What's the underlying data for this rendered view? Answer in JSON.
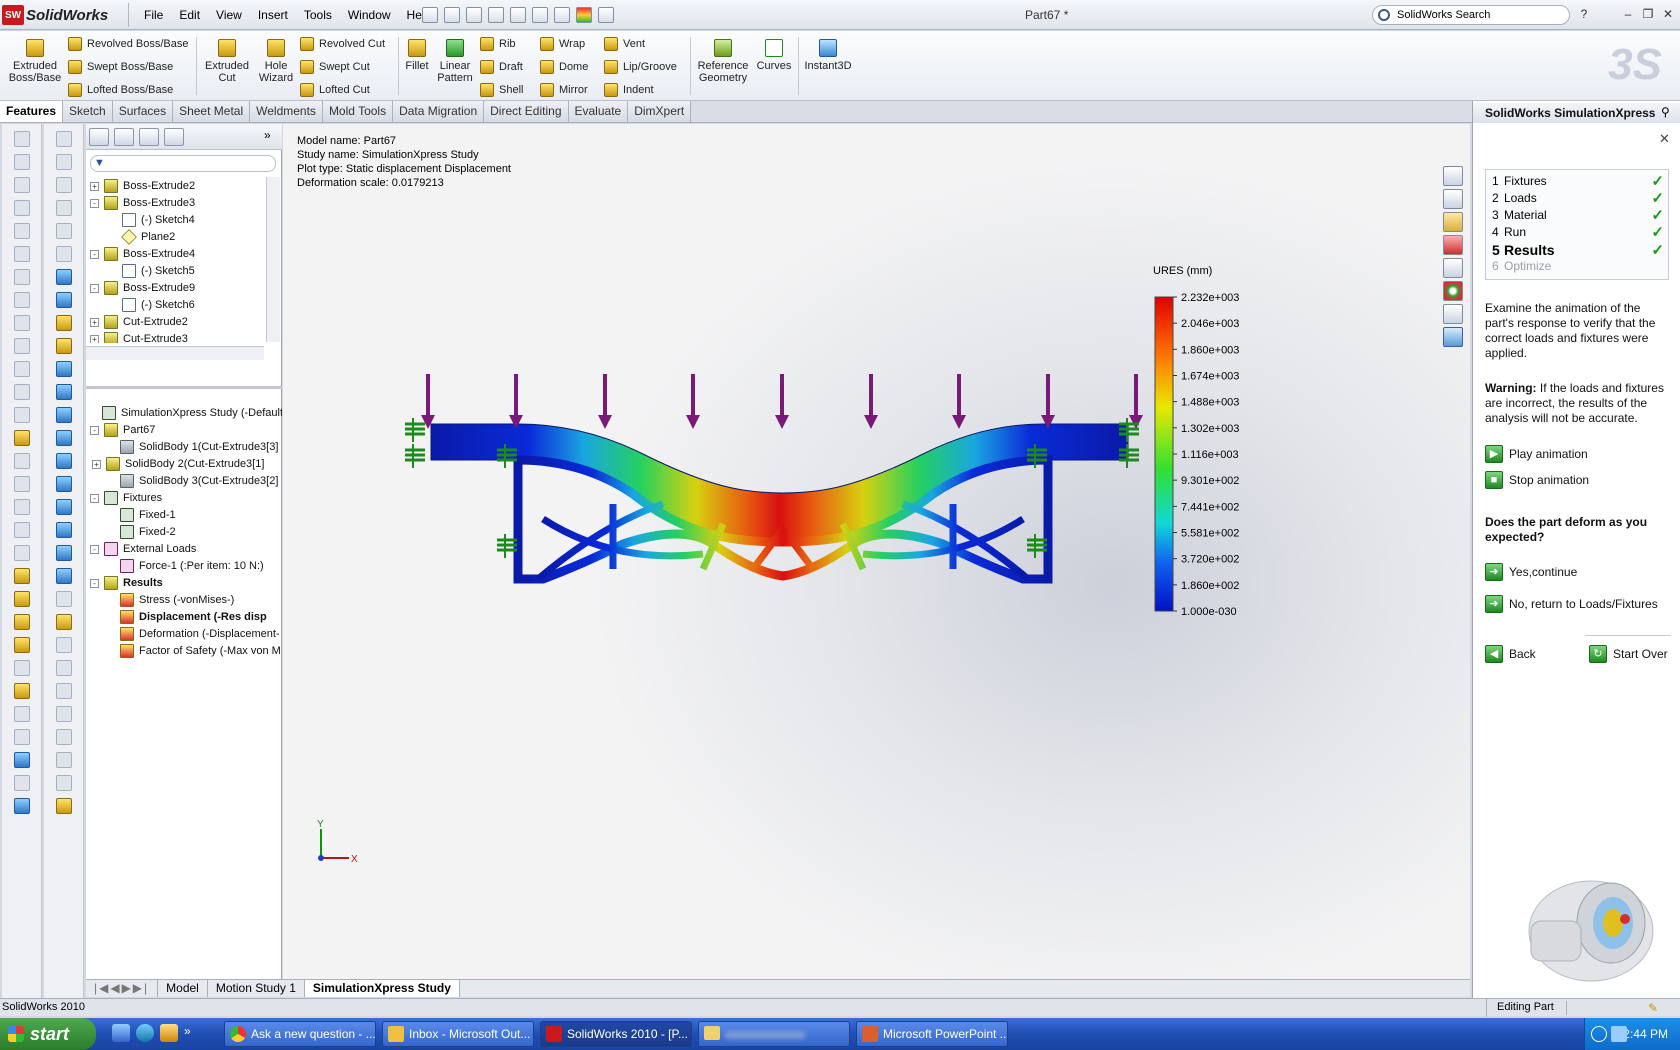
{
  "app": {
    "name": "SolidWorks",
    "logo": "SW",
    "doc_title": "Part67 *"
  },
  "menu": [
    "File",
    "Edit",
    "View",
    "Insert",
    "Tools",
    "Window",
    "Help"
  ],
  "search": {
    "placeholder": "SolidWorks Search"
  },
  "commands": {
    "extruded_boss": "Extruded Boss/Base",
    "revolved_boss": "Revolved Boss/Base",
    "swept_boss": "Swept Boss/Base",
    "lofted_boss": "Lofted Boss/Base",
    "extruded_cut": "Extruded Cut",
    "hole_wizard": "Hole Wizard",
    "revolved_cut": "Revolved Cut",
    "swept_cut": "Swept Cut",
    "lofted_cut": "Lofted Cut",
    "fillet": "Fillet",
    "linear_pattern": "Linear Pattern",
    "rib": "Rib",
    "draft": "Draft",
    "shell": "Shell",
    "wrap": "Wrap",
    "dome": "Dome",
    "mirror": "Mirror",
    "vent": "Vent",
    "lip_groove": "Lip/Groove",
    "indent": "Indent",
    "reference_geometry": "Reference Geometry",
    "curves": "Curves",
    "instant3d": "Instant3D"
  },
  "tabs": [
    "Features",
    "Sketch",
    "Surfaces",
    "Sheet Metal",
    "Weldments",
    "Mold Tools",
    "Data Migration",
    "Direct Editing",
    "Evaluate",
    "DimXpert"
  ],
  "feature_tree": [
    {
      "label": "Boss-Extrude2",
      "expand": "+",
      "icon": "feature"
    },
    {
      "label": "Boss-Extrude3",
      "expand": "-",
      "icon": "feature"
    },
    {
      "label": "(-) Sketch4",
      "expand": "",
      "icon": "sketch"
    },
    {
      "label": "Plane2",
      "expand": "",
      "icon": "plane"
    },
    {
      "label": "Boss-Extrude4",
      "expand": "-",
      "icon": "feature"
    },
    {
      "label": "(-) Sketch5",
      "expand": "",
      "icon": "sketch"
    },
    {
      "label": "Boss-Extrude9",
      "expand": "-",
      "icon": "feature"
    },
    {
      "label": "(-) Sketch6",
      "expand": "",
      "icon": "sketch"
    },
    {
      "label": "Cut-Extrude2",
      "expand": "+",
      "icon": "feature"
    },
    {
      "label": "Cut-Extrude3",
      "expand": "+",
      "icon": "feature"
    }
  ],
  "sim_tree": [
    {
      "label": "SimulationXpress Study (-Default-)",
      "expand": "",
      "icon": "study",
      "bold": false
    },
    {
      "label": "Part67",
      "expand": "-",
      "icon": "feature",
      "bold": false
    },
    {
      "label": "SolidBody 1(Cut-Extrude3[3]",
      "expand": "",
      "icon": "body",
      "bold": false
    },
    {
      "label": "SolidBody 2(Cut-Extrude3[1]",
      "expand": "+",
      "icon": "feature",
      "bold": false
    },
    {
      "label": "SolidBody 3(Cut-Extrude3[2]",
      "expand": "",
      "icon": "body",
      "bold": false
    },
    {
      "label": "Fixtures",
      "expand": "-",
      "icon": "fixture",
      "bold": false
    },
    {
      "label": "Fixed-1",
      "expand": "",
      "icon": "fixture",
      "bold": false
    },
    {
      "label": "Fixed-2",
      "expand": "",
      "icon": "fixture",
      "bold": false
    },
    {
      "label": "External Loads",
      "expand": "-",
      "icon": "load",
      "bold": false
    },
    {
      "label": "Force-1 (:Per item: 10 N:)",
      "expand": "",
      "icon": "load",
      "bold": false
    },
    {
      "label": "Results",
      "expand": "-",
      "icon": "feature",
      "bold": true
    },
    {
      "label": "Stress (-vonMises-)",
      "expand": "",
      "icon": "result",
      "bold": false
    },
    {
      "label": "Displacement (-Res disp",
      "expand": "",
      "icon": "result",
      "bold": true
    },
    {
      "label": "Deformation (-Displacement-",
      "expand": "",
      "icon": "result",
      "bold": false
    },
    {
      "label": "Factor of Safety (-Max von M",
      "expand": "",
      "icon": "result",
      "bold": false
    }
  ],
  "graphics": {
    "model_name": "Model name: Part67",
    "study_name": "Study name: SimulationXpress Study",
    "plot_type": "Plot type: Static displacement Displacement",
    "deformation_scale": "Deformation scale: 0.0179213",
    "legend_title": "URES (mm)",
    "legend_values": [
      "2.232e+003",
      "2.046e+003",
      "1.860e+003",
      "1.674e+003",
      "1.488e+003",
      "1.302e+003",
      "1.116e+003",
      "9.301e+002",
      "7.441e+002",
      "5.581e+002",
      "3.720e+002",
      "1.860e+002",
      "1.000e-030"
    ],
    "axis_y": "Y",
    "axis_x": "X",
    "load_color": "#7a1a78",
    "fixture_color": "#1e8a1e"
  },
  "bottom_tabs": [
    "Model",
    "Motion Study 1",
    "SimulationXpress Study"
  ],
  "task_pane": {
    "title": "SolidWorks SimulationXpress",
    "steps": [
      {
        "num": "1",
        "label": "Fixtures",
        "done": "✓"
      },
      {
        "num": "2",
        "label": "Loads",
        "done": "✓"
      },
      {
        "num": "3",
        "label": "Material",
        "done": "✓"
      },
      {
        "num": "4",
        "label": "Run",
        "done": "✓"
      },
      {
        "num": "5",
        "label": "Results",
        "done": "✓"
      },
      {
        "num": "6",
        "label": "Optimize",
        "done": ""
      }
    ],
    "instructions": "Examine the animation of the part's response to verify that the correct loads and fixtures were applied.",
    "warning_label": "Warning:",
    "warning_text": "If the loads and fixtures are incorrect, the results of the analysis will not be accurate.",
    "play": "Play animation",
    "stop": "Stop animation",
    "question": "Does the part deform as you expected?",
    "yes": "Yes,continue",
    "no": "No, return to Loads/Fixtures",
    "back": "Back",
    "start_over": "Start Over"
  },
  "status": {
    "left": "SolidWorks 2010",
    "right": "Editing Part"
  },
  "taskbar": {
    "start": "start",
    "items": [
      "Ask a new question - ...",
      "Inbox - Microsoft Out...",
      "SolidWorks 2010 - [P...",
      "",
      "Microsoft PowerPoint ..."
    ],
    "clock": "2:44 PM"
  }
}
